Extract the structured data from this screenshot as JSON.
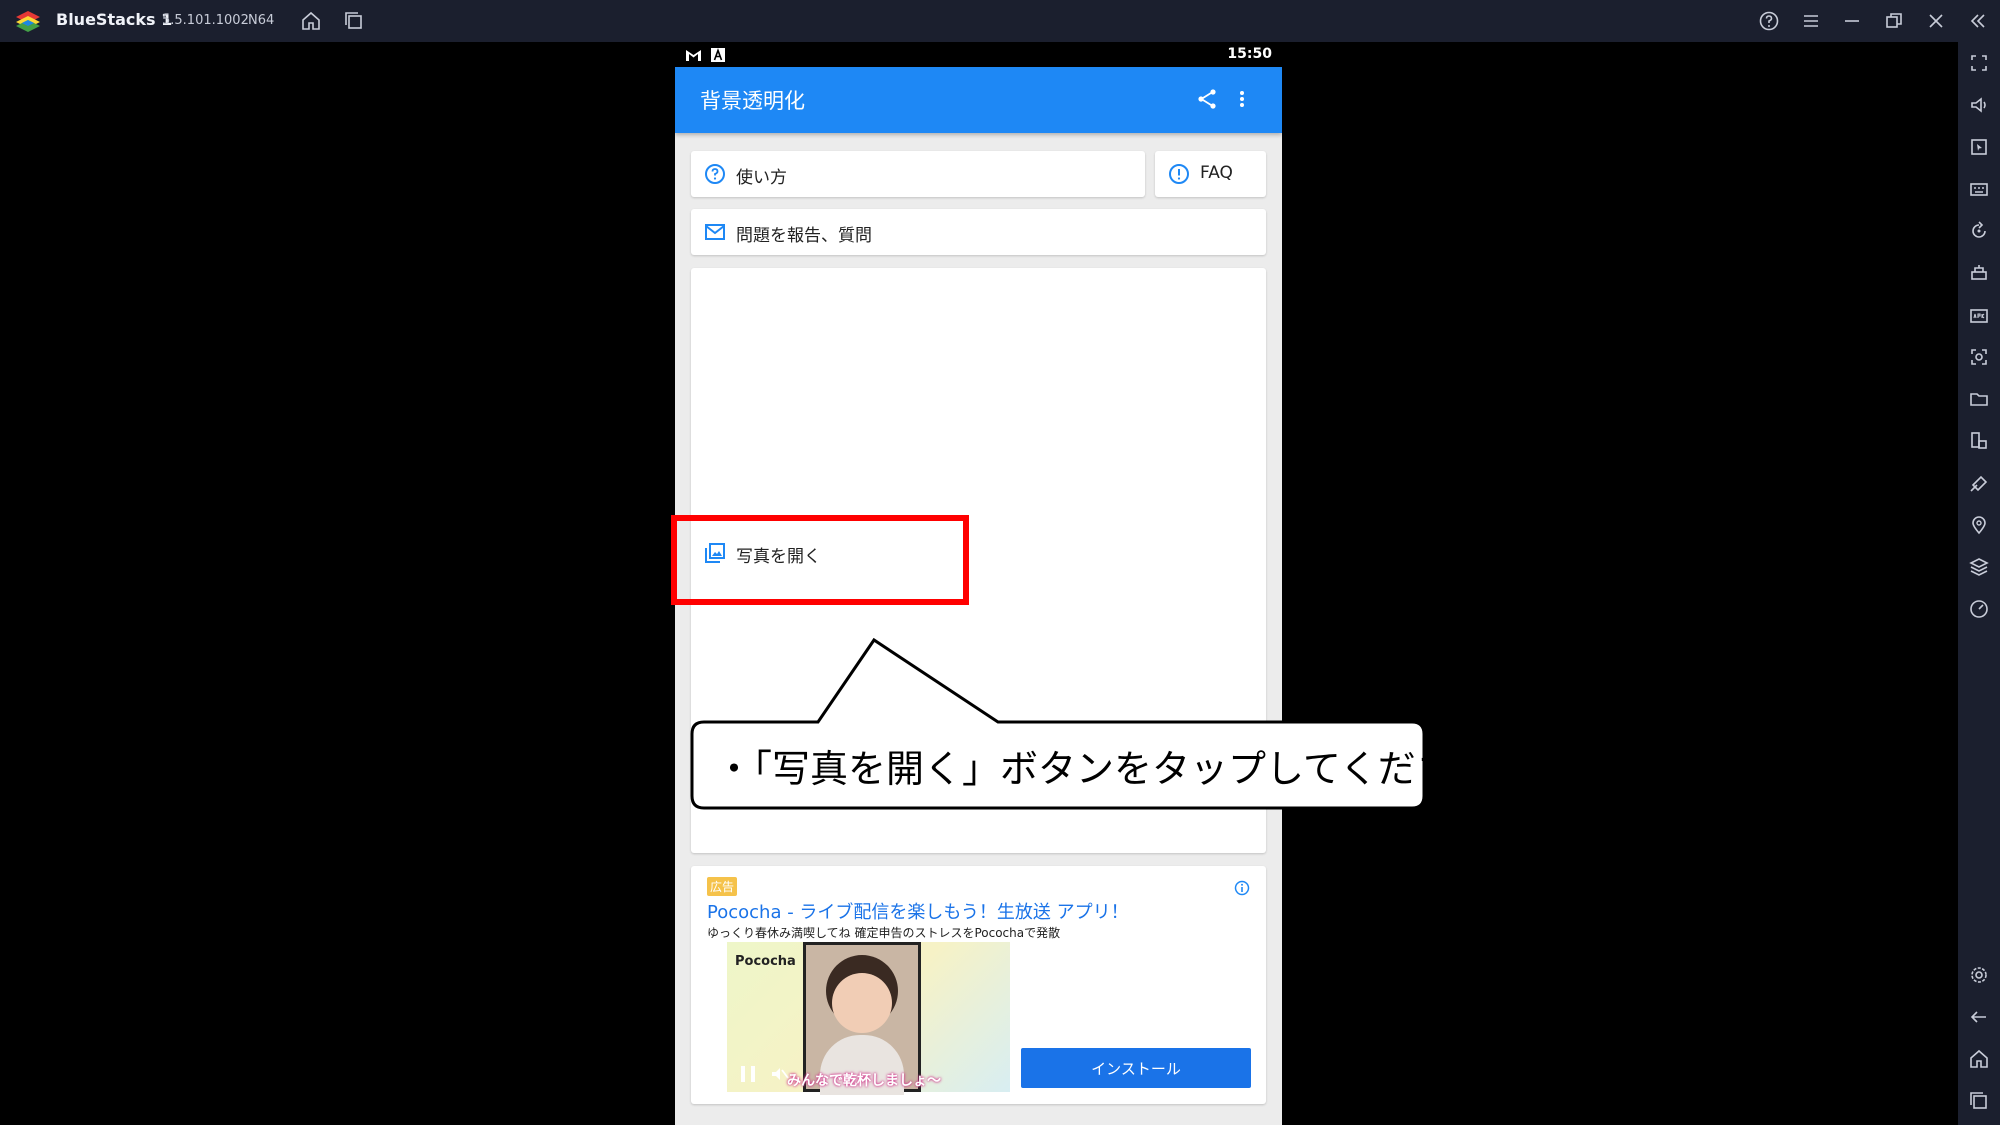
{
  "window": {
    "app_name": "BlueStacks 1",
    "version": "5.5.101.1002",
    "arch": "N64"
  },
  "android": {
    "time": "15:50"
  },
  "app": {
    "title": "背景透明化",
    "accent_color": "#1e88f5",
    "buttons": {
      "how_to": "使い方",
      "faq": "FAQ",
      "report": "問題を報告、質問",
      "open_photo": "写真を開く"
    }
  },
  "annotation": {
    "callout_text": "・「写真を開く」ボタンをタップしてください",
    "highlight_color": "#ff0000"
  },
  "ad": {
    "badge": "広告",
    "title": "Pococha - ライブ配信を楽しもう！生放送 アプリ！",
    "description": "ゆっくり春休み満喫してね 確定申告のストレスをPocochaで発散",
    "image_brand": "Pococha",
    "image_caption": "みんなで乾杯しましょ〜",
    "install_label": "インストール"
  }
}
